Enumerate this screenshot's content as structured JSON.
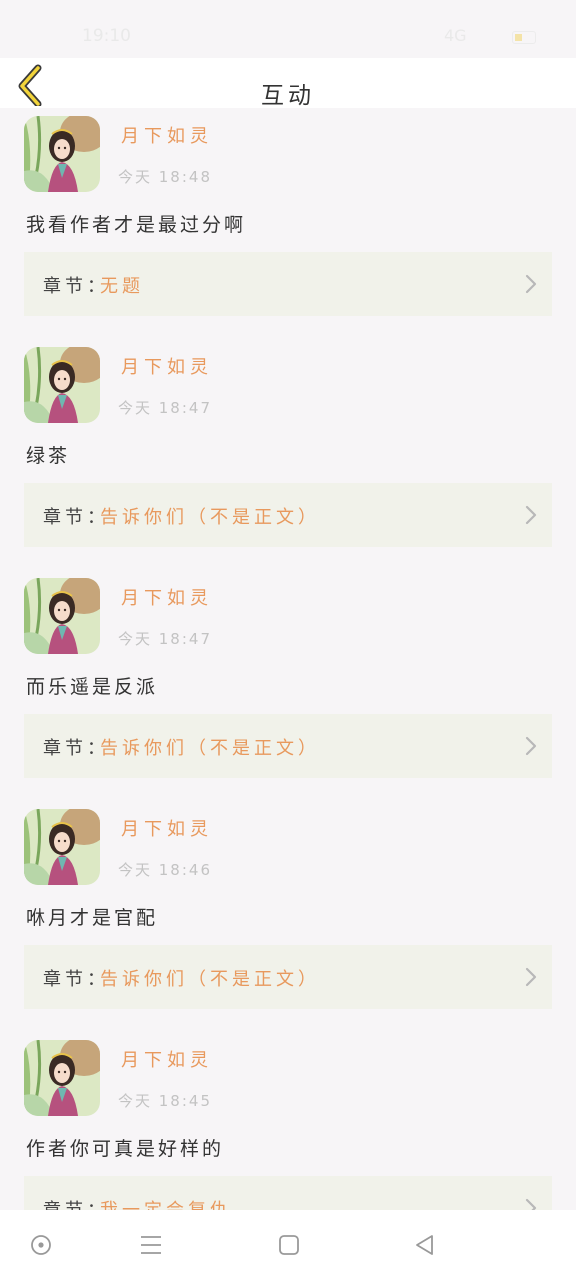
{
  "status_bar": {
    "time": "19:10",
    "signal": "4G"
  },
  "header": {
    "title": "互动"
  },
  "comments": [
    {
      "user": "月下如灵",
      "time": "今天 18:48",
      "text": "我看作者才是最过分啊",
      "chapter_label": "章节：",
      "chapter": "无题"
    },
    {
      "user": "月下如灵",
      "time": "今天 18:47",
      "text": "绿茶",
      "chapter_label": "章节：",
      "chapter": "告诉你们（不是正文）"
    },
    {
      "user": "月下如灵",
      "time": "今天 18:47",
      "text": "而乐遥是反派",
      "chapter_label": "章节：",
      "chapter": "告诉你们（不是正文）"
    },
    {
      "user": "月下如灵",
      "time": "今天 18:46",
      "text": "咻月才是官配",
      "chapter_label": "章节：",
      "chapter": "告诉你们（不是正文）"
    },
    {
      "user": "月下如灵",
      "time": "今天 18:45",
      "text": "作者你可真是好样的",
      "chapter_label": "章节：",
      "chapter": "我一定会复仇"
    }
  ],
  "icons": {
    "back": "chevron-left-icon",
    "chapter_arrow": "chevron-right-icon",
    "nav": [
      "circle-dot-icon",
      "menu-icon",
      "square-icon",
      "triangle-back-icon"
    ]
  },
  "colors": {
    "accent": "#e8995d",
    "back_arrow": "#f2d43a",
    "chapter_bg": "#f1f2ea"
  }
}
